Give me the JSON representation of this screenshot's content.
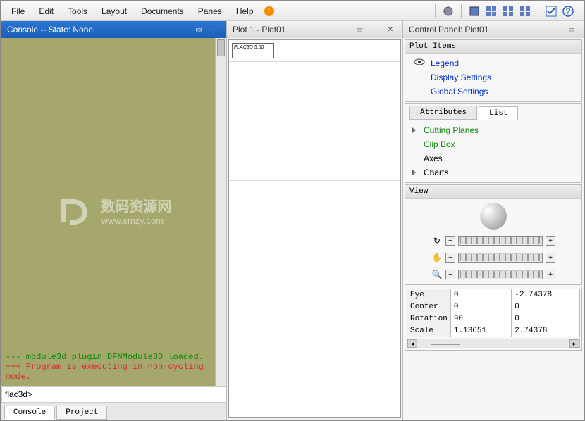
{
  "menubar": {
    "items": [
      "File",
      "Edit",
      "Tools",
      "Layout",
      "Documents",
      "Panes",
      "Help"
    ]
  },
  "toolbar": {
    "alert": "!",
    "icons": [
      "globe-icon",
      "sheet-icon",
      "grid-icon-1",
      "grid-icon-2",
      "grid-icon-3",
      "check-icon",
      "help-icon"
    ]
  },
  "console": {
    "title": "Console -- State: None",
    "msg1": "--- module3d plugin DFNModule3D loaded.",
    "msg2": "+++ Program is executing in non-cycling mode.",
    "prompt": "flac3d>",
    "input_value": "",
    "tabs": [
      "Console",
      "Project"
    ],
    "watermark_cn": "数码资源网",
    "watermark_url": "www.smzy.com"
  },
  "plot": {
    "title": "Plot 1 - Plot01",
    "legend_label": "FLAC3D 5.00"
  },
  "control": {
    "title": "Control Panel: Plot01",
    "plot_items_header": "Plot Items",
    "plot_items": [
      "Legend",
      "Display Settings",
      "Global Settings"
    ],
    "tabs": [
      "Attributes",
      "List"
    ],
    "list_items": [
      {
        "label": "Cutting Planes",
        "expandable": true,
        "color": "green"
      },
      {
        "label": "Clip Box",
        "expandable": false,
        "color": "green"
      },
      {
        "label": "Axes",
        "expandable": false,
        "color": "black"
      },
      {
        "label": "Charts",
        "expandable": true,
        "color": "black"
      }
    ],
    "view_header": "View",
    "sliders": [
      "rotate-icon",
      "pan-icon",
      "zoom-icon"
    ],
    "coords": {
      "rows": [
        {
          "k": "Eye",
          "a": "0",
          "b": "-2.74378"
        },
        {
          "k": "Center",
          "a": "0",
          "b": "0"
        },
        {
          "k": "Rotation",
          "a": "90",
          "b": "0"
        },
        {
          "k": "Scale",
          "a": "1.13651",
          "b": "2.74378"
        }
      ]
    }
  }
}
